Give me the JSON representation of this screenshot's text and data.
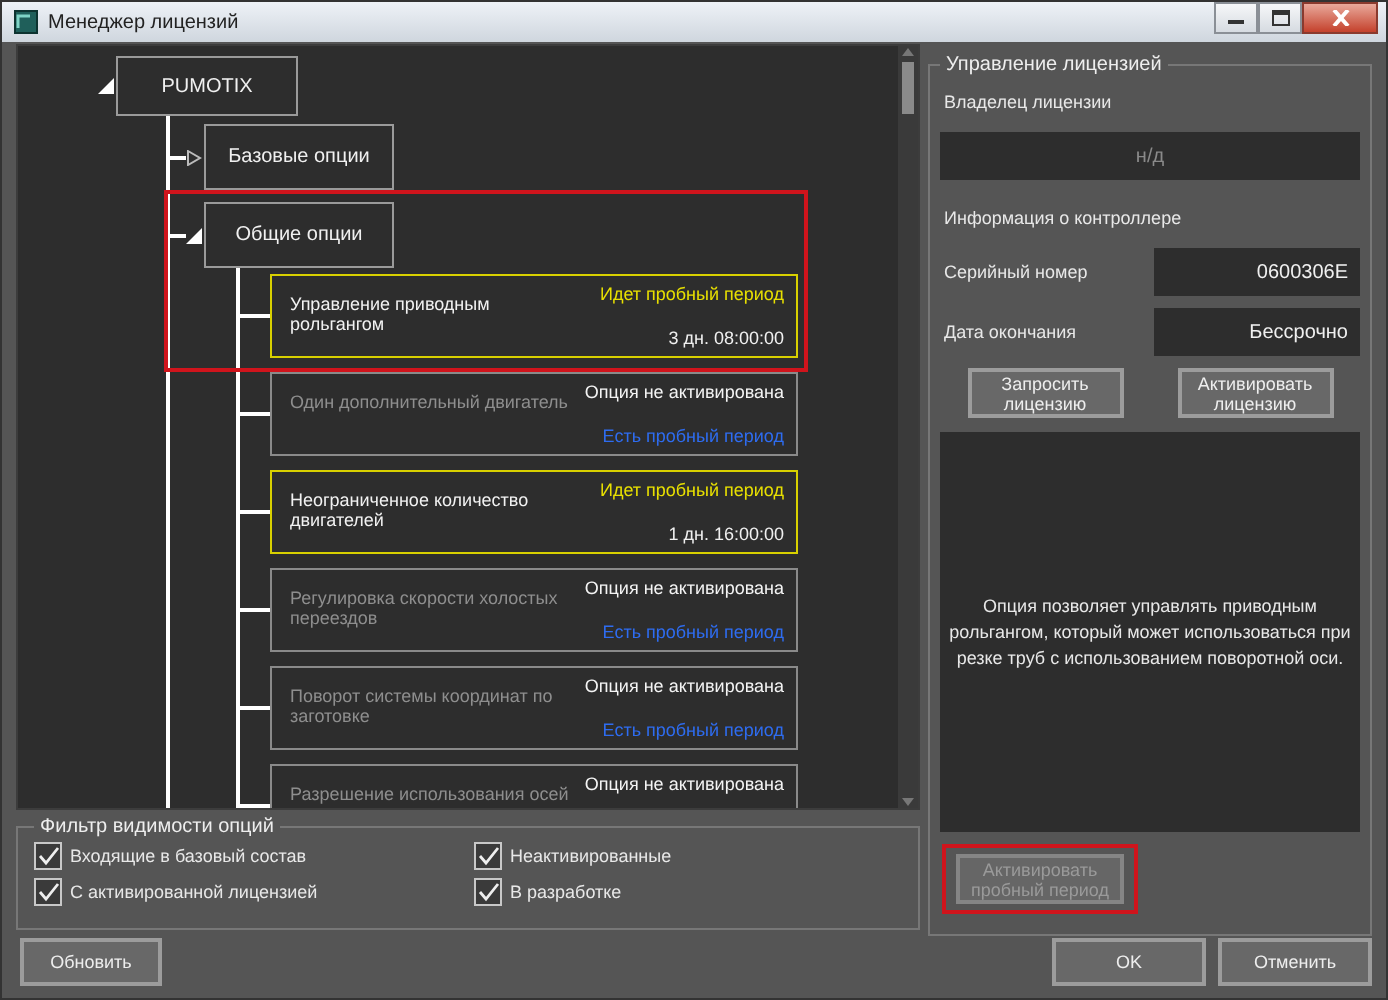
{
  "window": {
    "title": "Менеджер лицензий"
  },
  "tree": {
    "label": "PUMOTIX",
    "expanded": true,
    "children": [
      {
        "label": "Базовые опции",
        "expanded": false,
        "highlighted": false
      },
      {
        "label": "Общие опции",
        "expanded": true,
        "highlighted": true,
        "options": [
          {
            "name": "Управление приводным рольгангом",
            "kind": "trial",
            "status": "Идет пробный период",
            "detail": "3 дн. 08:00:00"
          },
          {
            "name": "Один дополнительный двигатель",
            "kind": "inactive",
            "status": "Опция не активирована",
            "detail": "Есть пробный период"
          },
          {
            "name": "Неограниченное количество двигателей",
            "kind": "trial",
            "status": "Идет пробный период",
            "detail": "1 дн. 16:00:00"
          },
          {
            "name": "Регулировка скорости холостых переездов",
            "kind": "inactive",
            "status": "Опция не активирована",
            "detail": "Есть пробный период"
          },
          {
            "name": "Поворот системы координат по заготовке",
            "kind": "inactive",
            "status": "Опция не активирована",
            "detail": "Есть пробный период"
          },
          {
            "name": "Разрешение использования осей",
            "kind": "inactive",
            "status": "Опция не активирована"
          }
        ]
      }
    ]
  },
  "filter": {
    "title": "Фильтр видимости опций",
    "items": [
      {
        "label": "Входящие в базовый состав",
        "checked": true
      },
      {
        "label": "Неактивированные",
        "checked": true
      },
      {
        "label": "С активированной лицензией",
        "checked": true
      },
      {
        "label": "В разработке",
        "checked": true
      }
    ]
  },
  "license": {
    "title": "Управление лицензией",
    "owner_label": "Владелец лицензии",
    "owner_value": "н/д",
    "controller_heading": "Информация о контроллере",
    "fields": [
      {
        "label": "Серийный номер",
        "value": "0600306E"
      },
      {
        "label": "Дата окончания",
        "value": "Бессрочно"
      }
    ],
    "buttons": [
      "Запросить лицензию",
      "Активировать лицензию"
    ],
    "description": "Опция позволяет управлять приводным рольгангом, который может использоваться при резке труб с использованием поворотной оси.",
    "trial_button": {
      "label": "Активировать пробный период",
      "disabled": true,
      "highlighted": true
    }
  },
  "footer": {
    "refresh": "Обновить",
    "ok": "OK",
    "cancel": "Отменить"
  }
}
